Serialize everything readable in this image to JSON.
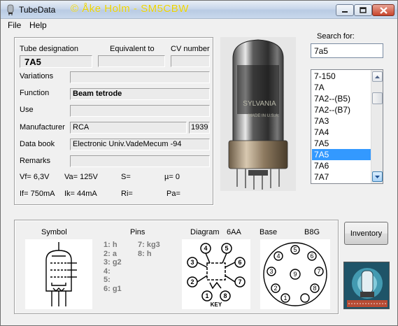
{
  "window": {
    "title": "TubeData",
    "credit": "© Åke Holm - SM5CBW"
  },
  "menu": {
    "file": "File",
    "help": "Help"
  },
  "header": {
    "tube_designation_label": "Tube designation",
    "equivalent_label": "Equivalent to",
    "cv_label": "CV number",
    "tube_designation_value": "7A5",
    "equivalent_value": "",
    "cv_value": ""
  },
  "fields": {
    "variations_label": "Variations",
    "variations_value": "",
    "function_label": "Function",
    "function_value": "Beam tetrode",
    "use_label": "Use",
    "use_value": "",
    "manufacturer_label": "Manufacturer",
    "manufacturer_value": "RCA",
    "year_value": "1939",
    "databook_label": "Data book",
    "databook_value": "Electronic Univ.VadeMecum -94",
    "remarks_label": "Remarks",
    "remarks_value": ""
  },
  "params": {
    "vf": "Vf= 6,3V",
    "va": "Va= 125V",
    "s": "S=",
    "mu": "µ=   0",
    "if": "If= 750mA",
    "ik": "Ik=  44mA",
    "ri": "Ri=",
    "pa": "Pa="
  },
  "search": {
    "label": "Search for:",
    "value": "7a5"
  },
  "tube_list": {
    "items": [
      "7-150",
      "7A",
      "7A2--(B5)",
      "7A2--(B7)",
      "7A3",
      "7A4",
      "7A5",
      "7A5",
      "7A6",
      "7A7"
    ],
    "selected_index": 7
  },
  "photo": {
    "brand": "SYLVANIA",
    "made_in": "MADE IN U.S.A."
  },
  "bottom": {
    "symbol_label": "Symbol",
    "pins_label": "Pins",
    "diagram_label": "Diagram",
    "diagram_value": "6AA",
    "base_label": "Base",
    "base_value": "B8G",
    "pins_col1": [
      "1: h",
      "2: a",
      "3: g2",
      "4:",
      "5:",
      "6: g1"
    ],
    "pins_col2": [
      "7: kg3",
      "8: h"
    ],
    "diagram_pins": [
      "1",
      "2",
      "3",
      "4",
      "5",
      "6",
      "7",
      "8"
    ],
    "diagram_key": "KEY",
    "base_pins": [
      "1",
      "2",
      "3",
      "4",
      "5",
      "6",
      "7",
      "8",
      "9"
    ]
  },
  "inventory_button": "Inventory",
  "colors": {
    "selection": "#3399ff",
    "credit": "#e8d000",
    "window_bg": "#f0f0f0"
  }
}
